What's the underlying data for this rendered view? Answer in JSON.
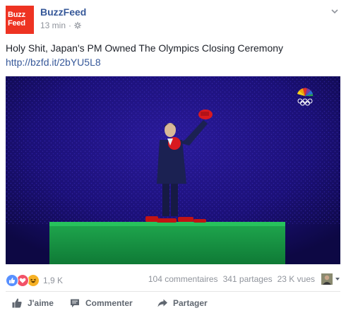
{
  "post": {
    "page_name": "BuzzFeed",
    "avatar": {
      "line1": "Buzz",
      "line2": "Feed",
      "color": "#ee3322"
    },
    "time": "13 min",
    "separator": "·",
    "privacy_icon": "gear-icon",
    "menu_icon": "chevron-down-icon",
    "text": "Holy Shit, Japan's PM Owned The Olympics Closing Ceremony",
    "link": "http://bzfd.it/2bYU5L8",
    "media": {
      "watermark_icon": "nbc-peacock-icon"
    }
  },
  "stats": {
    "reactions": [
      "like",
      "love",
      "haha"
    ],
    "reaction_count": "1,9 K",
    "comments": "104 commentaires",
    "shares": "341 partages",
    "views": "23 K vues"
  },
  "actions": {
    "like": "J'aime",
    "comment": "Commenter",
    "share": "Partager"
  },
  "colors": {
    "link": "#365899",
    "secondary_text": "#90949c",
    "like_blue": "#5890ff",
    "love_red": "#f25268",
    "haha_yellow": "#f7b125"
  }
}
